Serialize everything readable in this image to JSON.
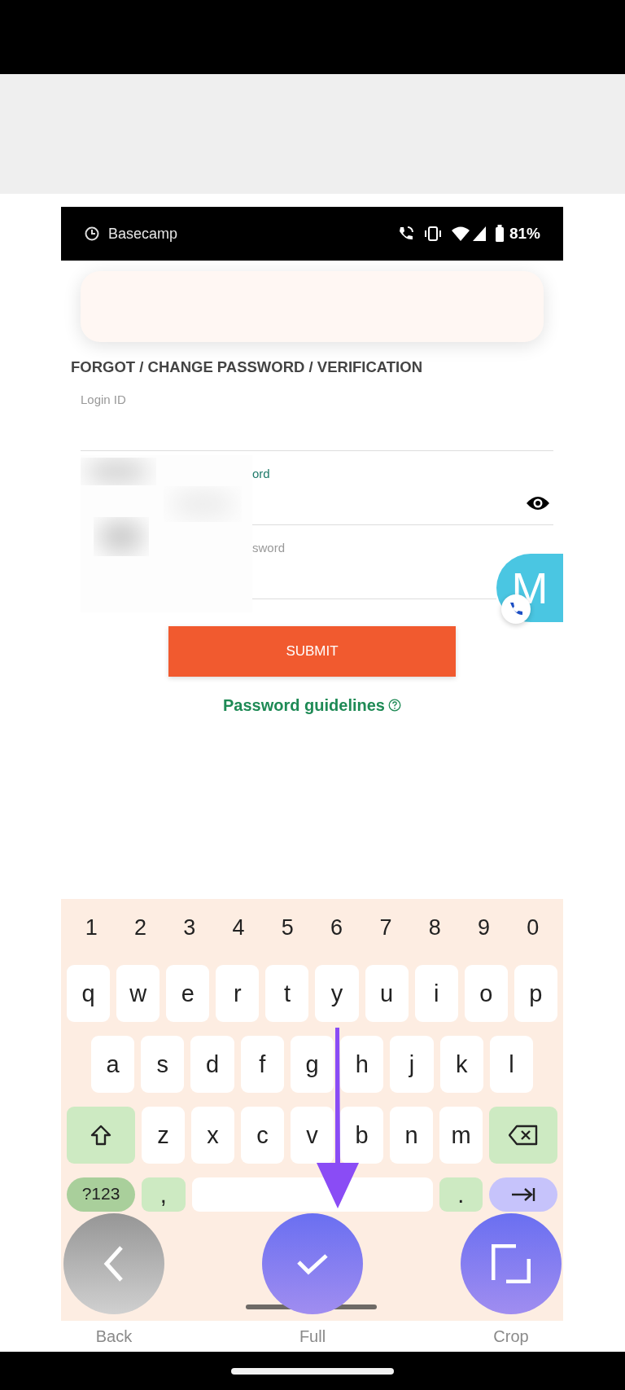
{
  "status_bar": {
    "app": "Basecamp",
    "battery": "81%"
  },
  "form": {
    "title": "FORGOT / CHANGE PASSWORD / VERIFICATION",
    "fields": [
      {
        "label": "Login ID",
        "focused": false,
        "partly_hidden": false,
        "reveal_icon": false
      },
      {
        "label": "ord",
        "focused": true,
        "partly_hidden": true,
        "reveal_icon": true
      },
      {
        "label": "sword",
        "focused": false,
        "partly_hidden": true,
        "reveal_icon": false
      }
    ],
    "submit": "SUBMIT",
    "guidelines_link": "Password guidelines"
  },
  "chat_avatar": {
    "letter": "M"
  },
  "keyboard": {
    "number_row": [
      "1",
      "2",
      "3",
      "4",
      "5",
      "6",
      "7",
      "8",
      "9",
      "0"
    ],
    "rows": [
      [
        "q",
        "w",
        "e",
        "r",
        "t",
        "y",
        "u",
        "i",
        "o",
        "p"
      ],
      [
        "a",
        "s",
        "d",
        "f",
        "g",
        "h",
        "j",
        "k",
        "l"
      ],
      [
        "z",
        "x",
        "c",
        "v",
        "b",
        "n",
        "m"
      ]
    ],
    "symbols": "?123",
    "comma": ",",
    "period": "."
  },
  "actions": [
    {
      "label": "Back",
      "kind": "back"
    },
    {
      "label": "Full",
      "kind": "confirm"
    },
    {
      "label": "Crop",
      "kind": "crop"
    }
  ]
}
